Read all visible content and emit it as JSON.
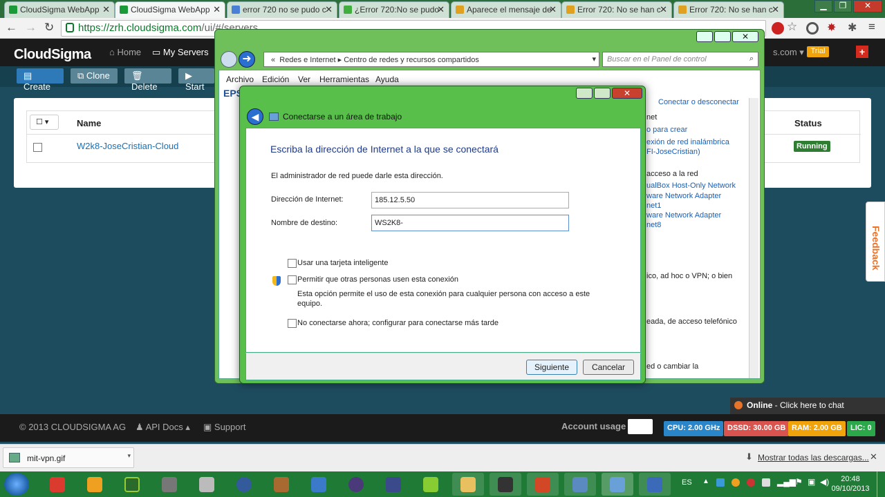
{
  "browser": {
    "tabs": [
      {
        "label": "CloudSigma WebApp",
        "icon": "cloudsigma-icon",
        "color": "#1b9a3a"
      },
      {
        "label": "CloudSigma WebApp",
        "icon": "cloudsigma-icon",
        "color": "#1b9a3a"
      },
      {
        "label": "error 720 no se pudo c",
        "icon": "google-icon",
        "color": "#4a7fd8"
      },
      {
        "label": "¿Error 720:No se pudo",
        "icon": "forum-icon",
        "color": "#3fae3f"
      },
      {
        "label": "Aparece el mensaje de",
        "icon": "microsoft-icon",
        "color": "#e0a020"
      },
      {
        "label": "Error 720: No se han c",
        "icon": "microsoft-icon",
        "color": "#e0a020"
      },
      {
        "label": "Error 720: No se han c",
        "icon": "microsoft-icon",
        "color": "#e0a020"
      }
    ],
    "url_host": "https://zrh.cloudsigma.com",
    "url_path": "/ui/#/servers"
  },
  "cloudsigma": {
    "logo": "CloudSigma",
    "nav": {
      "home": "Home",
      "servers": "My Servers"
    },
    "account_suffix": "s.com",
    "trial": "Trial",
    "toolbar": {
      "create": "Create",
      "clone": "Clone",
      "delete": "Delete",
      "start": "Start"
    },
    "table": {
      "col_name": "Name",
      "col_status": "Status",
      "row_name": "W2k8-JoseCristian-Cloud",
      "row_status": "Running"
    },
    "footer": {
      "copyright": "© 2013 CLOUDSIGMA AG",
      "api": "API Docs",
      "support": "Support",
      "account_usage": "Account usage",
      "cpu": "CPU: 2.00 GHz",
      "dssd": "DSSD: 30.00 GB",
      "ram": "RAM: 2.00 GB",
      "lic": "LIC: 0"
    },
    "chat": {
      "status": "Online",
      "text": " - Click here to chat"
    },
    "feedback": "Feedback"
  },
  "control_panel": {
    "breadcrumb": {
      "sep": "«",
      "item1": "Redes e Internet",
      "item2": "Centro de redes y recursos compartidos"
    },
    "search_placeholder": "Buscar en el Panel de control",
    "menu": {
      "archivo": "Archivo",
      "edicion": "Edición",
      "ver": "Ver",
      "herramientas": "Herramientas",
      "ayuda": "Ayuda"
    },
    "left_cut": "EPS",
    "right": {
      "connect": "Conectar o desconectar",
      "l1": "net",
      "l2": "o para crear",
      "l3": "exión de red inalámbrica",
      "l4": "FI-JoseCristian)",
      "l5": "acceso a la red",
      "l6": "ualBox Host-Only Network",
      "l7": "ware Network Adapter",
      "l8": "net1",
      "l9": "ware Network Adapter",
      "l10": "net8",
      "l11": "ico, ad hoc o VPN; o bien",
      "l12": "eada, de acceso telefónico",
      "l13": "ed o cambiar la"
    }
  },
  "dialog": {
    "title": "Conectarse a un área de trabajo",
    "heading": "Escriba la dirección de Internet a la que se conectará",
    "hint": "El administrador de red puede darle esta dirección.",
    "address_label": "Dirección de Internet:",
    "address_value": "185.12.5.50",
    "dest_label": "Nombre de destino:",
    "dest_value": "WS2K8-",
    "opt_smartcard": "Usar una tarjeta inteligente",
    "opt_allow": "Permitir que otras personas usen esta conexión",
    "opt_allow_desc1": "Esta opción permite el uso de esta conexión para cualquier persona con acceso a este",
    "opt_allow_desc2": "equipo.",
    "opt_later": "No conectarse ahora; configurar para conectarse más tarde",
    "next": "Siguiente",
    "cancel": "Cancelar"
  },
  "downloads": {
    "file": "mit-vpn.gif",
    "show_all": "Mostrar todas las descargas..."
  },
  "taskbar": {
    "lang": "ES",
    "time": "20:48",
    "date": "09/10/2013",
    "apps": [
      "chrome-icon",
      "outlook-icon",
      "dreamweaver-icon",
      "paint-icon",
      "tool-icon",
      "network-icon",
      "gimp-icon",
      "jcreator-icon",
      "eclipse-icon",
      "devcpp-icon",
      "android-icon",
      "folder-icon",
      "games-icon",
      "powerpoint-icon",
      "rdp-icon",
      "control-panel-icon",
      "remote-desktop-icon"
    ]
  }
}
